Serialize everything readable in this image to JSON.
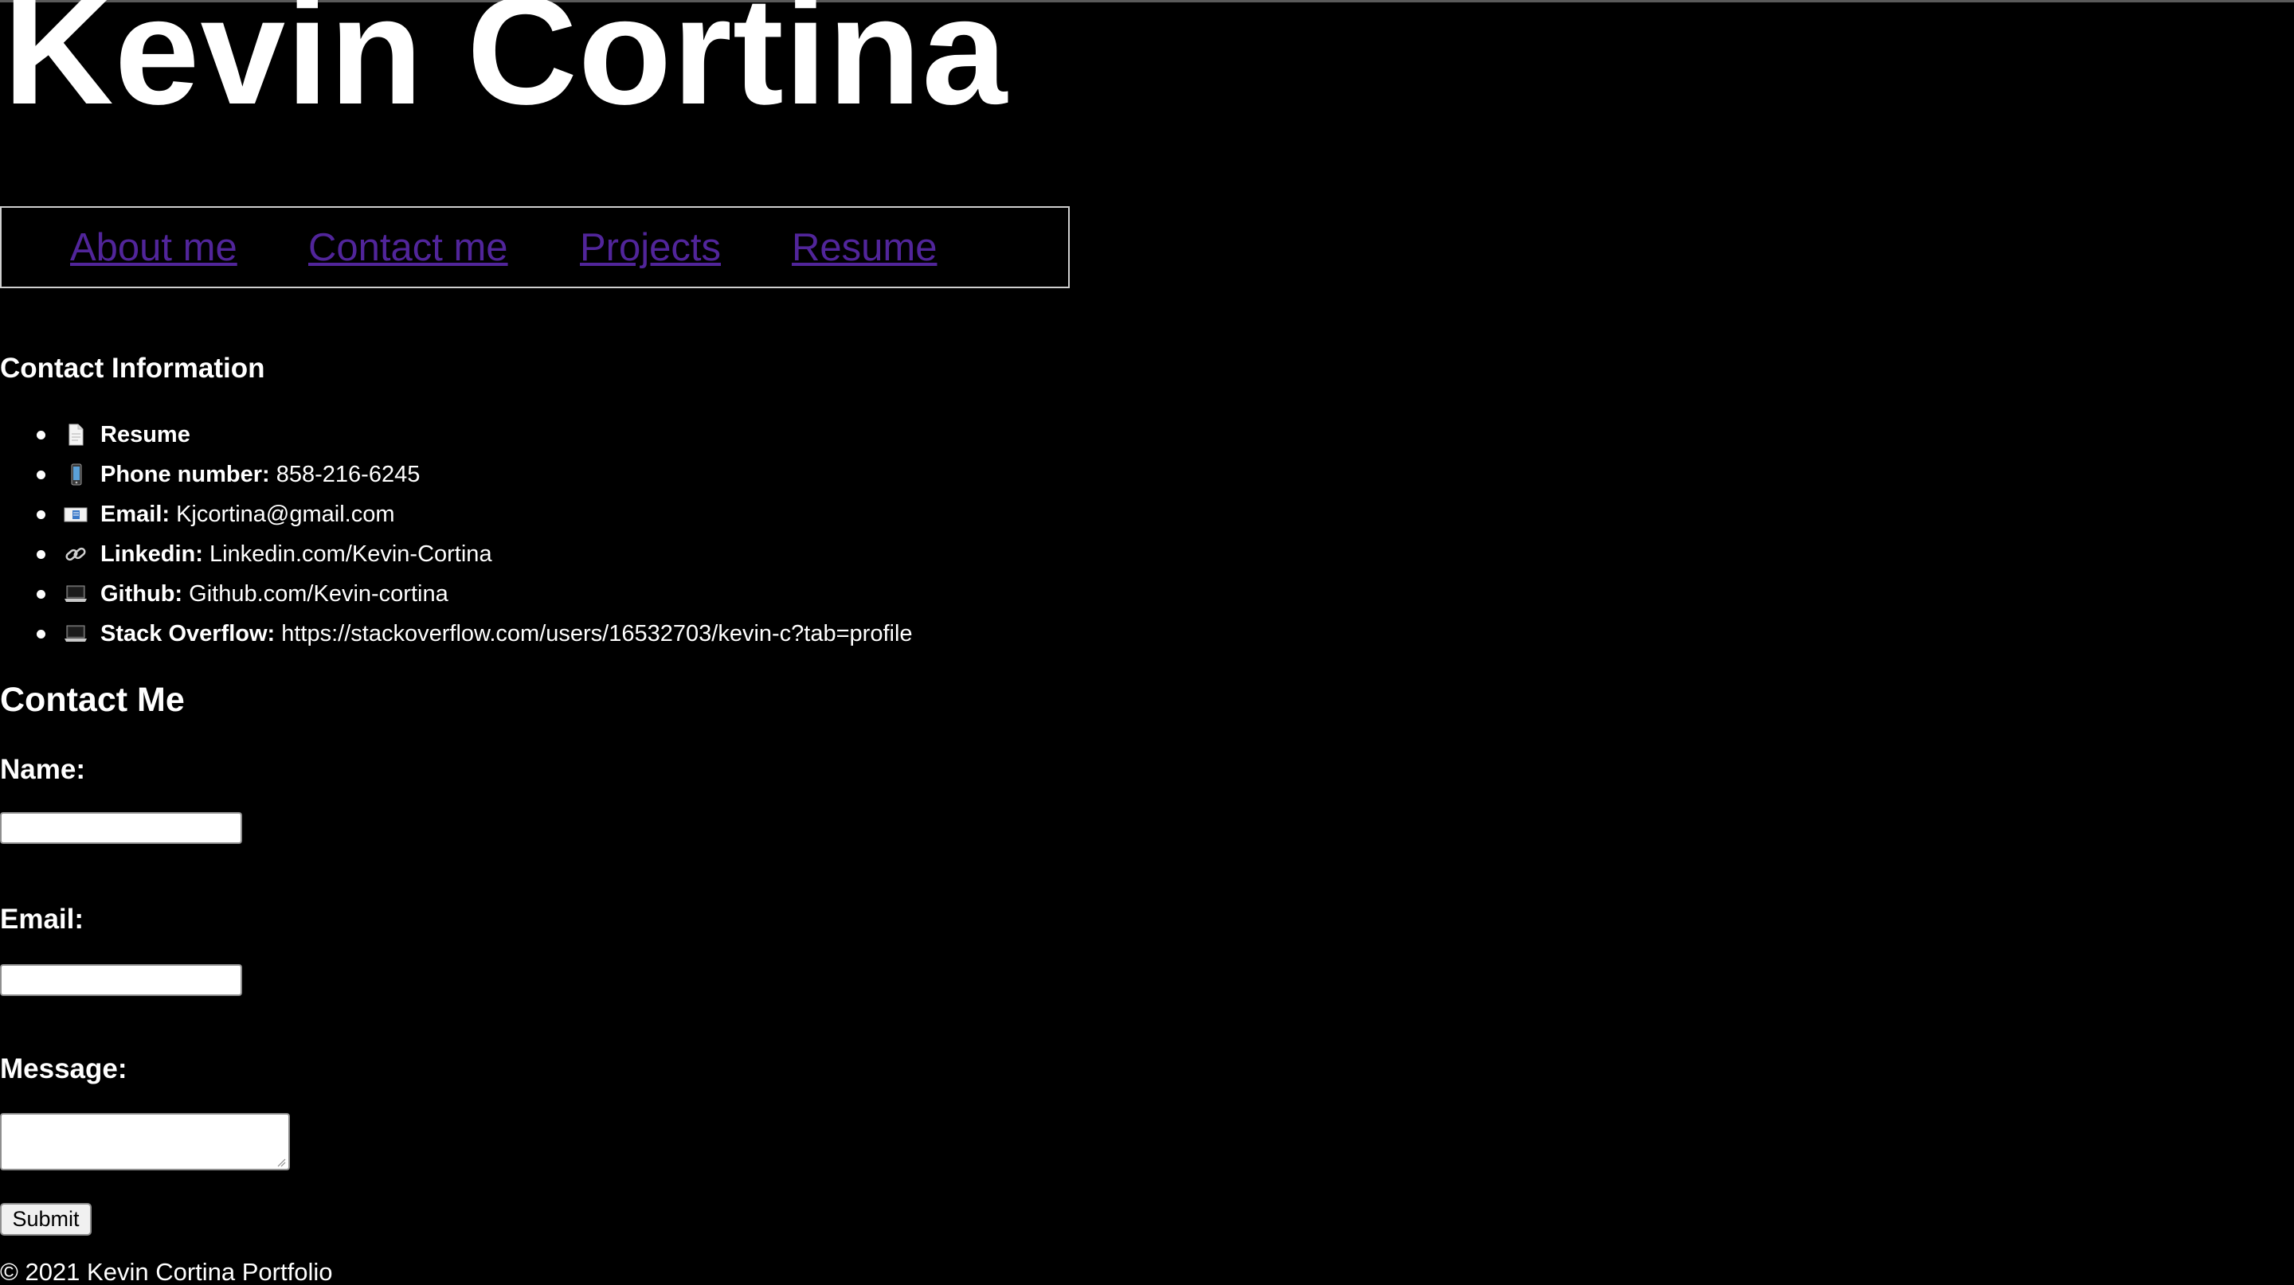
{
  "header": {
    "title": "Kevin Cortina"
  },
  "nav": {
    "items": [
      {
        "label": "About me"
      },
      {
        "label": "Contact me"
      },
      {
        "label": "Projects"
      },
      {
        "label": "Resume"
      }
    ],
    "link_color": "#51259a"
  },
  "contact_info": {
    "heading": "Contact Information",
    "items": [
      {
        "icon": "document-icon",
        "label": "Resume",
        "value": ""
      },
      {
        "icon": "mobile-phone-icon",
        "label": "Phone number:",
        "value": "858-216-6245"
      },
      {
        "icon": "email-icon",
        "label": "Email:",
        "value": "Kjcortina@gmail.com"
      },
      {
        "icon": "link-icon",
        "label": "Linkedin:",
        "value": "Linkedin.com/Kevin-Cortina"
      },
      {
        "icon": "laptop-icon",
        "label": "Github:",
        "value": "Github.com/Kevin-cortina"
      },
      {
        "icon": "laptop-icon",
        "label": "Stack Overflow:",
        "value": "https://stackoverflow.com/users/16532703/kevin-c?tab=profile"
      }
    ]
  },
  "contact_form": {
    "heading": "Contact Me",
    "name_label": "Name:",
    "name_value": "",
    "email_label": "Email:",
    "email_value": "",
    "message_label": "Message:",
    "message_value": "",
    "submit_label": "Submit"
  },
  "footer": {
    "text": "© 2021 Kevin Cortina Portfolio"
  },
  "colors": {
    "background": "#000000",
    "text": "#ffffff",
    "link": "#51259a"
  }
}
